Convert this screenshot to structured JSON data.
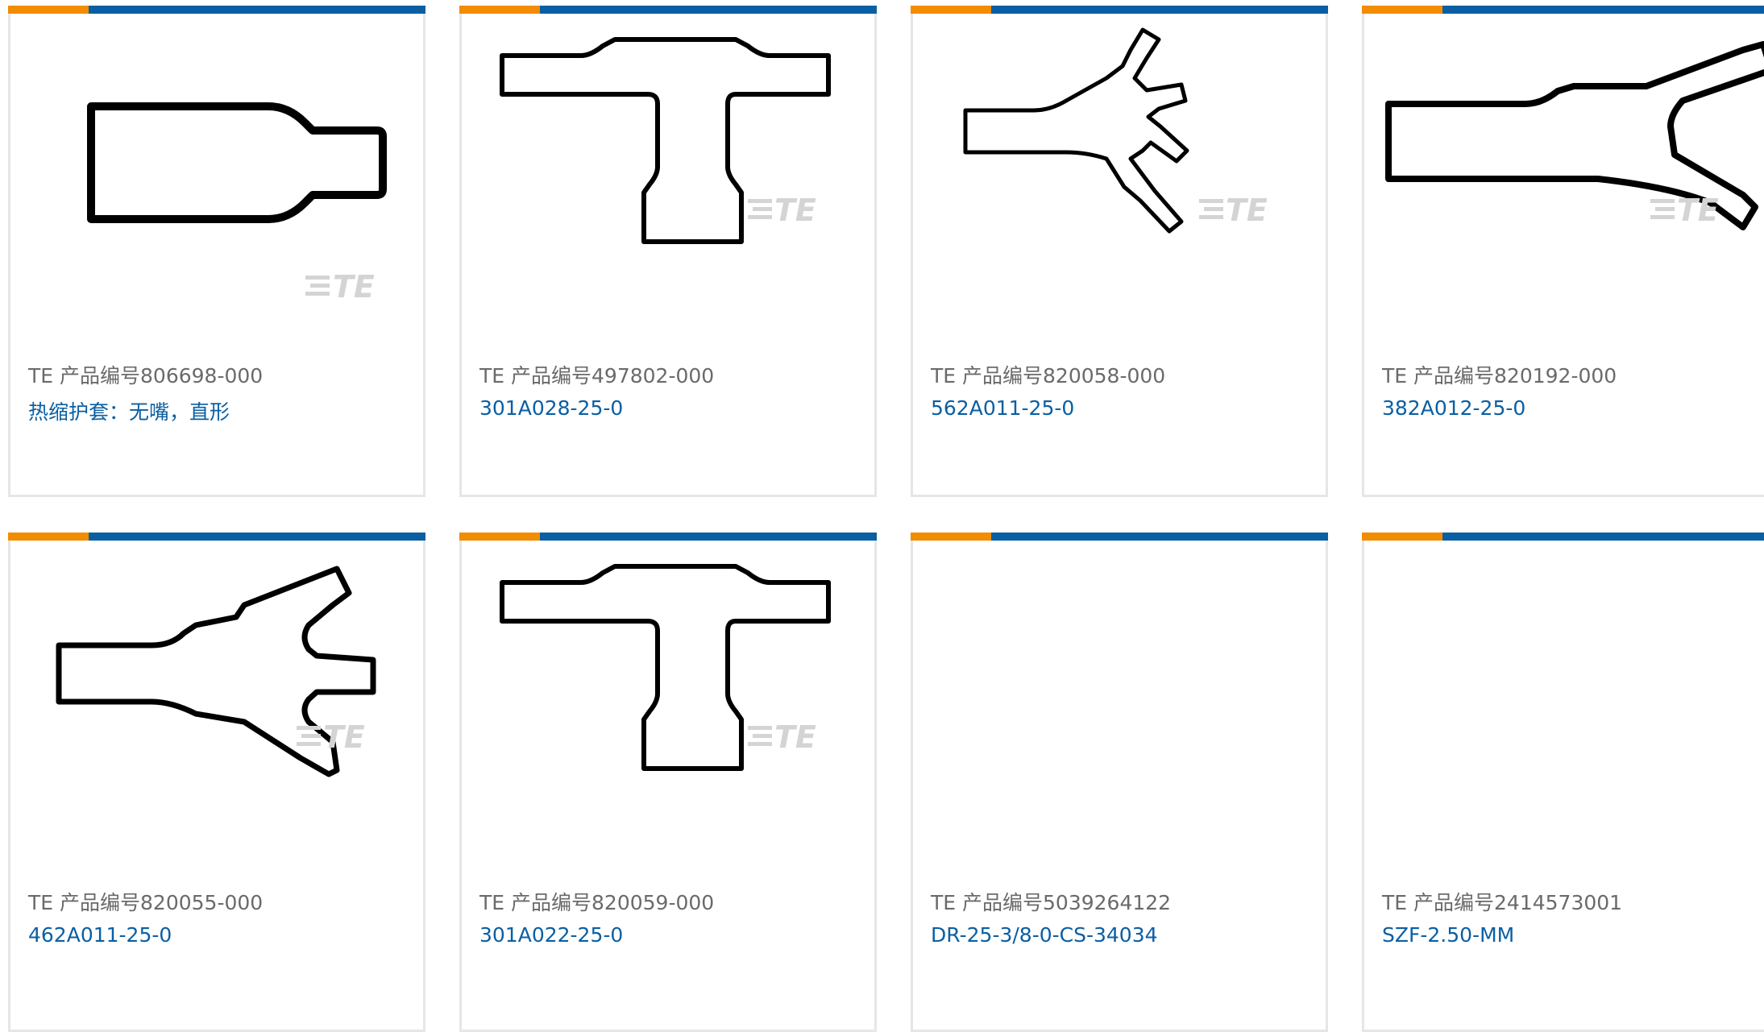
{
  "products": [
    {
      "pn_prefix": "TE 产品编号",
      "pn": "806698-000",
      "desc": "热缩护套：无嘴，直形",
      "icon": "straight-boot-icon"
    },
    {
      "pn_prefix": "TE 产品编号",
      "pn": "497802-000",
      "desc": "301A028-25-0",
      "icon": "tee-boot-icon"
    },
    {
      "pn_prefix": "TE 产品编号",
      "pn": "820058-000",
      "desc": "562A011-25-0",
      "icon": "four-way-boot-icon"
    },
    {
      "pn_prefix": "TE 产品编号",
      "pn": "820192-000",
      "desc": "382A012-25-0",
      "icon": "y-boot-icon"
    },
    {
      "pn_prefix": "TE 产品编号",
      "pn": "820055-000",
      "desc": "462A011-25-0",
      "icon": "three-way-boot-icon"
    },
    {
      "pn_prefix": "TE 产品编号",
      "pn": "820059-000",
      "desc": "301A022-25-0",
      "icon": "tee-boot-icon"
    },
    {
      "pn_prefix": "TE 产品编号",
      "pn": "5039264122",
      "desc": "DR-25-3/8-0-CS-34034",
      "icon": "no-image"
    },
    {
      "pn_prefix": "TE 产品编号",
      "pn": "2414573001",
      "desc": "SZF-2.50-MM",
      "icon": "no-image"
    }
  ],
  "watermark_text": "TE",
  "colors": {
    "accent_orange": "#f28c00",
    "brand_blue": "#0a5fa3",
    "part_number_gray": "#6a6a6a"
  }
}
